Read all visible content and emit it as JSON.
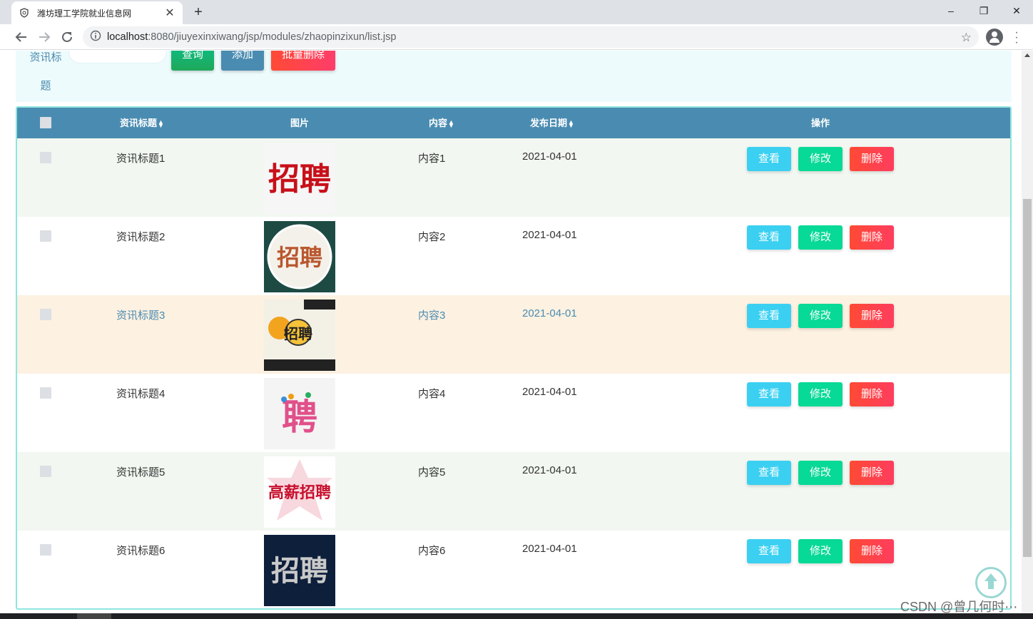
{
  "browser": {
    "tab_title": "潍坊理工学院就业信息网",
    "url_host": "localhost",
    "url_rest": ":8080/jiuyexinxiwang/jsp/modules/zhaopinzixun/list.jsp",
    "window_controls": {
      "minimize": "–",
      "restore": "❐",
      "close": "✕"
    },
    "new_tab": "+",
    "tab_close": "✕"
  },
  "search": {
    "label_line1": "资讯标",
    "label_line2": "题",
    "query_button": "查询",
    "add_button": "添加",
    "batch_delete_button": "批量删除"
  },
  "table": {
    "headers": {
      "title": "资讯标题",
      "image": "图片",
      "content": "内容",
      "date": "发布日期",
      "actions": "操作"
    },
    "action_labels": {
      "view": "查看",
      "edit": "修改",
      "delete": "删除"
    },
    "rows": [
      {
        "title": "资讯标题1",
        "content": "内容1",
        "date": "2021-04-01",
        "image_text": "招聘"
      },
      {
        "title": "资讯标题2",
        "content": "内容2",
        "date": "2021-04-01",
        "image_text": "招聘"
      },
      {
        "title": "资讯标题3",
        "content": "内容3",
        "date": "2021-04-01",
        "image_text": "招聘"
      },
      {
        "title": "资讯标题4",
        "content": "内容4",
        "date": "2021-04-01",
        "image_text": "聘"
      },
      {
        "title": "资讯标题5",
        "content": "内容5",
        "date": "2021-04-01",
        "image_text": "高薪招聘"
      },
      {
        "title": "资讯标题6",
        "content": "内容6",
        "date": "2021-04-01",
        "image_text": "招聘"
      }
    ]
  },
  "watermark": "CSDN @曾几何时⋯",
  "colors": {
    "header_bg": "#4a8cb1",
    "row_alt_bg": "#f2f7f1",
    "row_highlight_bg": "#fdf1e1",
    "view_button": "#3bd0f2",
    "edit_button": "#07d996",
    "delete_button": "#ff4a35"
  }
}
